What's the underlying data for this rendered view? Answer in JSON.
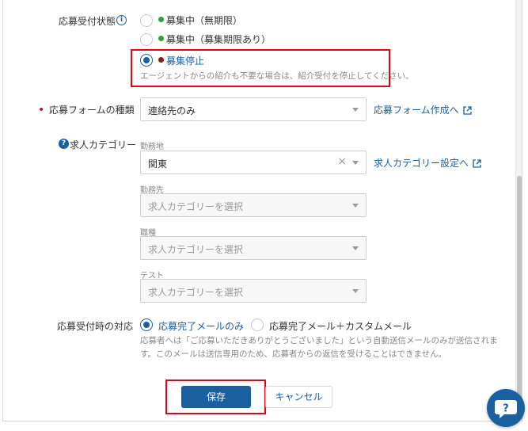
{
  "status_section": {
    "label": "応募受付状態",
    "info_icon": "i",
    "options": [
      {
        "label": "募集中（無期限）",
        "dot_color": "#2e9e3e",
        "checked": false
      },
      {
        "label": "募集中（募集期限あり）",
        "dot_color": "#2e9e3e",
        "checked": false
      },
      {
        "label": "募集停止",
        "dot_color": "#8b1a1a",
        "checked": true
      }
    ],
    "stop_hint": "エージェントからの紹介も不要な場合は、紹介受付を停止してください。"
  },
  "form_type": {
    "label": "応募フォームの種類",
    "required_mark": "•",
    "selected": "連絡先のみ",
    "link": "応募フォーム作成へ"
  },
  "job_category": {
    "help_icon": "?",
    "label": "求人カテゴリー",
    "link": "求人カテゴリー設定へ",
    "fields": [
      {
        "label": "勤務地",
        "value": "関東",
        "clear": "×"
      },
      {
        "label": "勤務先",
        "placeholder": "求人カテゴリーを選択"
      },
      {
        "label": "職種",
        "placeholder": "求人カテゴリーを選択"
      },
      {
        "label": "テスト",
        "placeholder": "求人カテゴリーを選択"
      }
    ]
  },
  "response": {
    "label": "応募受付時の対応",
    "options": [
      {
        "label": "応募完了メールのみ",
        "checked": true
      },
      {
        "label": "応募完了メール＋カスタムメール",
        "checked": false
      }
    ],
    "note_line1": "応募者へは「ご応募いただきありがとうございました」という自動送信メールのみが送信されま",
    "note_line2": "す。このメールは送信専用のため、応募者からの返信を受けることはできません。"
  },
  "actions": {
    "save": "保存",
    "cancel": "キャンセル"
  },
  "colors": {
    "accent": "#1a5fa0",
    "highlight": "#e60012"
  }
}
